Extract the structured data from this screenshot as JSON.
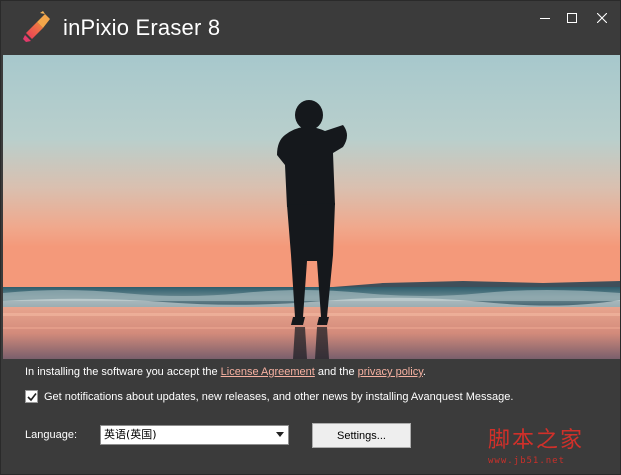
{
  "window": {
    "title": "inPixio Eraser 8",
    "controls": [
      "minimize-icon",
      "maximize-icon",
      "close-icon"
    ]
  },
  "hero": {
    "description_icon": "person-silhouette-beach-sunset"
  },
  "license": {
    "prefix": "In installing the software you accept the ",
    "license_link": "License Agreement",
    "middle": " and the ",
    "privacy_link": "privacy policy",
    "suffix": "."
  },
  "notifications": {
    "checked": true,
    "label": "Get notifications about updates, new releases, and other news by installing Avanquest Message."
  },
  "language": {
    "label": "Language:",
    "selected": "英语(英国)"
  },
  "settings": {
    "label": "Settings..."
  },
  "watermark": {
    "text": "脚本之家",
    "url": "www.jb51.net"
  },
  "colors": {
    "background": "#3b3b3b",
    "link": "#f7b1a1",
    "watermark": "#d0302a"
  }
}
